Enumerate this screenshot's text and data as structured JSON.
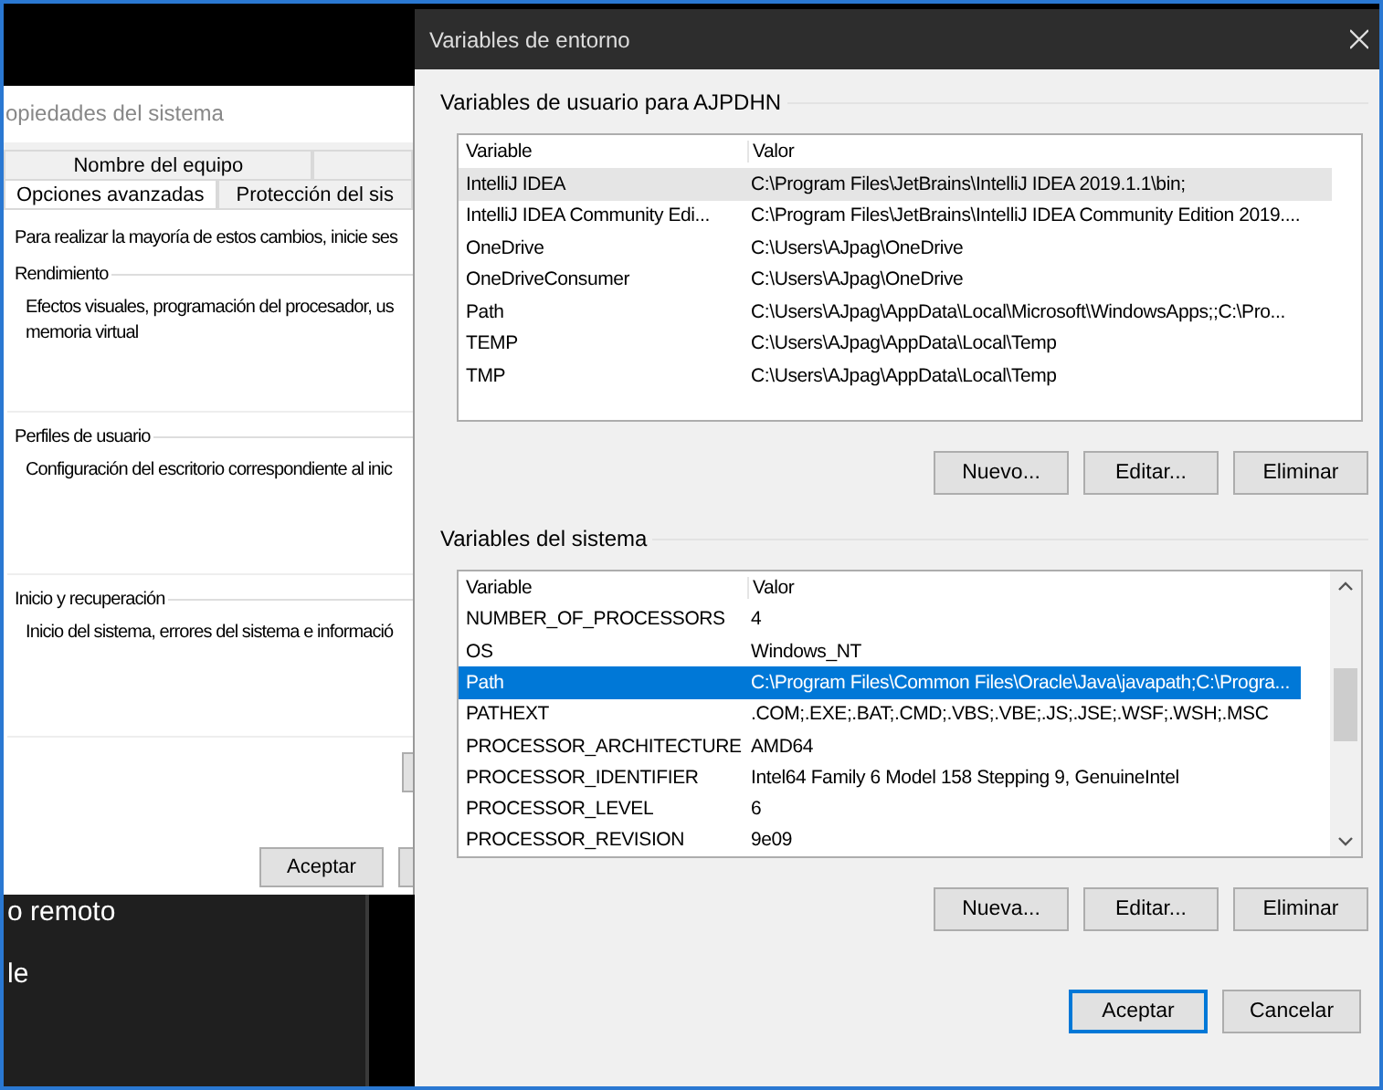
{
  "desktop": {
    "texts": [
      "o remoto",
      "le"
    ]
  },
  "system_properties": {
    "title": "opiedades del sistema",
    "back_tabs": [
      {
        "label": "Nombre del equipo",
        "selected": false
      }
    ],
    "tabs": [
      {
        "label": "Opciones avanzadas",
        "selected": true
      },
      {
        "label": "Protección del sis",
        "selected": false
      }
    ],
    "intro": "Para realizar la mayoría de estos cambios, inicie ses",
    "groups": [
      {
        "title": "Rendimiento",
        "lines": [
          "Efectos visuales, programación del procesador, us",
          "memoria virtual"
        ]
      },
      {
        "title": "Perfiles de usuario",
        "lines": [
          "Configuración del escritorio correspondiente al inic"
        ]
      },
      {
        "title": "Inicio y recuperación",
        "lines": [
          "Inicio del sistema, errores del sistema e informació"
        ]
      }
    ],
    "buttons": [
      "Aceptar"
    ]
  },
  "environment_variables": {
    "title": "Variables de entorno",
    "sections": [
      {
        "title": "Variables de usuario para AJPDHN",
        "focused": false,
        "columns": [
          "Variable",
          "Valor"
        ],
        "rows": [
          {
            "name": "IntelliJ IDEA",
            "value": "C:\\Program Files\\JetBrains\\IntelliJ IDEA 2019.1.1\\bin;",
            "selected": true
          },
          {
            "name": "IntelliJ IDEA Community Edi...",
            "value": "C:\\Program Files\\JetBrains\\IntelliJ IDEA Community Edition 2019....",
            "selected": false
          },
          {
            "name": "OneDrive",
            "value": "C:\\Users\\AJpag\\OneDrive",
            "selected": false
          },
          {
            "name": "OneDriveConsumer",
            "value": "C:\\Users\\AJpag\\OneDrive",
            "selected": false
          },
          {
            "name": "Path",
            "value": "C:\\Users\\AJpag\\AppData\\Local\\Microsoft\\WindowsApps;;C:\\Pro...",
            "selected": false
          },
          {
            "name": "TEMP",
            "value": "C:\\Users\\AJpag\\AppData\\Local\\Temp",
            "selected": false
          },
          {
            "name": "TMP",
            "value": "C:\\Users\\AJpag\\AppData\\Local\\Temp",
            "selected": false
          }
        ],
        "buttons": [
          "Nuevo...",
          "Editar...",
          "Eliminar"
        ],
        "scrollbar": false
      },
      {
        "title": "Variables del sistema",
        "focused": true,
        "columns": [
          "Variable",
          "Valor"
        ],
        "rows": [
          {
            "name": "NUMBER_OF_PROCESSORS",
            "value": "4",
            "selected": false
          },
          {
            "name": "OS",
            "value": "Windows_NT",
            "selected": false
          },
          {
            "name": "Path",
            "value": "C:\\Program Files\\Common Files\\Oracle\\Java\\javapath;C:\\Progra...",
            "selected": true
          },
          {
            "name": "PATHEXT",
            "value": ".COM;.EXE;.BAT;.CMD;.VBS;.VBE;.JS;.JSE;.WSF;.WSH;.MSC",
            "selected": false
          },
          {
            "name": "PROCESSOR_ARCHITECTURE",
            "value": "AMD64",
            "selected": false
          },
          {
            "name": "PROCESSOR_IDENTIFIER",
            "value": "Intel64 Family 6 Model 158 Stepping 9, GenuineIntel",
            "selected": false
          },
          {
            "name": "PROCESSOR_LEVEL",
            "value": "6",
            "selected": false
          },
          {
            "name": "PROCESSOR_REVISION",
            "value": "9e09",
            "selected": false
          }
        ],
        "buttons": [
          "Nueva...",
          "Editar...",
          "Eliminar"
        ],
        "scrollbar": true
      }
    ],
    "buttons": [
      {
        "label": "Aceptar",
        "default": true
      },
      {
        "label": "Cancelar",
        "default": false
      }
    ]
  }
}
